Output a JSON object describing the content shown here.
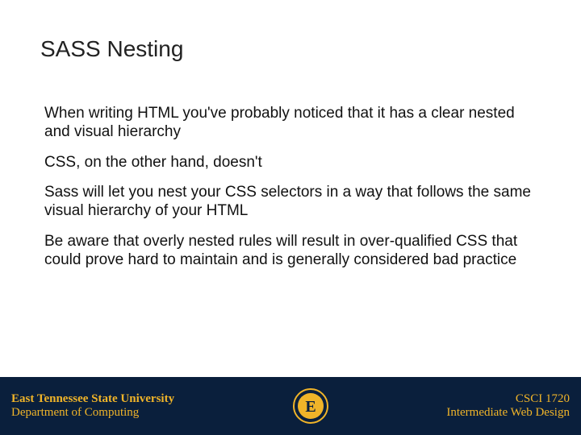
{
  "slide": {
    "title": "SASS Nesting",
    "paragraphs": [
      "When writing HTML you've probably noticed that it has a clear nested and visual hierarchy",
      "CSS, on the other hand, doesn't",
      "Sass will let you nest your CSS selectors in a way that follows the same visual hierarchy of your HTML",
      "Be aware that overly nested rules will result in over-qualified CSS that could prove hard to maintain and is generally considered bad practice"
    ]
  },
  "footer": {
    "left_line1": "East Tennessee State University",
    "left_line2": "Department of Computing",
    "right_line1": "CSCI 1720",
    "right_line2": "Intermediate Web Design",
    "logo_letter": "E"
  },
  "colors": {
    "footer_bg": "#0a1f3c",
    "accent": "#f0b429"
  }
}
